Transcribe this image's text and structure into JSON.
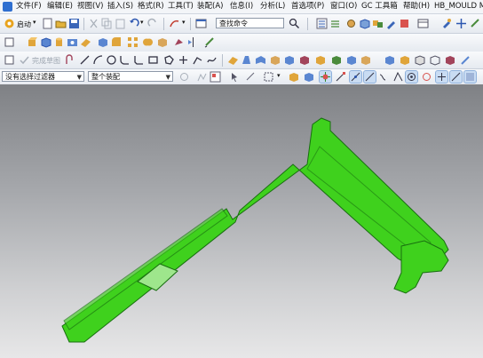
{
  "menu": {
    "items": [
      "文件(F)",
      "编辑(E)",
      "视图(V)",
      "插入(S)",
      "格式(R)",
      "工具(T)",
      "装配(A)",
      "信息(I)",
      "分析(L)",
      "首选项(P)",
      "窗口(O)",
      "GC 工具箱",
      "帮助(H)",
      "HB_MOULD M"
    ]
  },
  "toolbar1": {
    "start_label": "启动",
    "search_value": "查找命令"
  },
  "toolbar2": {
    "complete_sketch_label": "完成草图"
  },
  "toolbar3": {
    "selection_filter_value": "没有选择过滤器",
    "assembly_scope_value": "整个装配"
  },
  "viewport": {
    "model_color": "#3fd11d",
    "model_edge_color": "#186e10"
  }
}
